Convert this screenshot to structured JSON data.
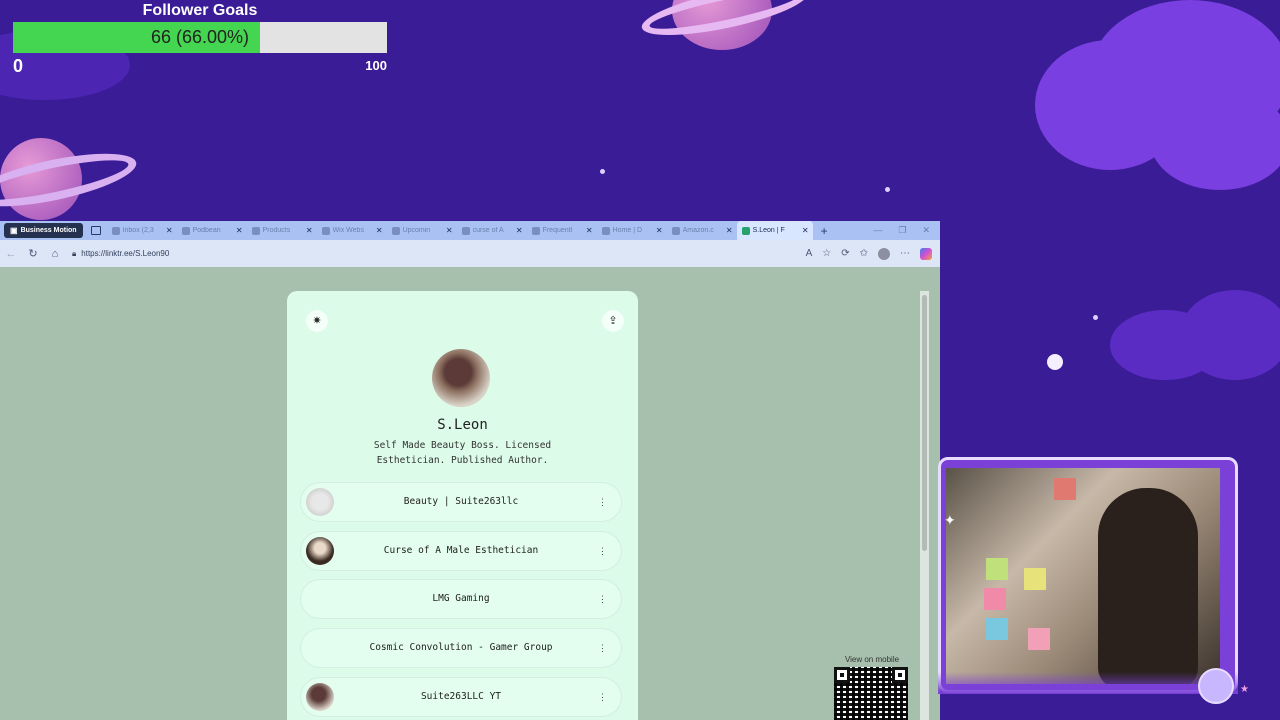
{
  "overlay": {
    "goal": {
      "title": "Follower Goals",
      "value_text": "66 (66.00%)",
      "min": "0",
      "max": "100",
      "progress": 0.66,
      "fill_color": "#44d650"
    }
  },
  "browser": {
    "workspace_label": "Business Motion",
    "tabs": [
      {
        "label": "Inbox (2,3",
        "active": false
      },
      {
        "label": "Podbean",
        "active": false
      },
      {
        "label": "Products",
        "active": false
      },
      {
        "label": "Wix Webs",
        "active": false
      },
      {
        "label": "Upcomin",
        "active": false
      },
      {
        "label": "curse of A",
        "active": false
      },
      {
        "label": "Frequentl",
        "active": false
      },
      {
        "label": "Home | D",
        "active": false
      },
      {
        "label": "Amazon.c",
        "active": false
      },
      {
        "label": "S.Leon | F",
        "active": true
      }
    ],
    "new_tab": "+",
    "url": "https://linktr.ee/S.Leon90"
  },
  "page": {
    "name": "S.Leon",
    "bio": "Self Made Beauty Boss. Licensed Esthetician. Published Author.",
    "links": [
      {
        "label": "Beauty | Suite263llc",
        "thumb": "logo"
      },
      {
        "label": "Curse of A Male Esthetician",
        "thumb": "book"
      },
      {
        "label": "LMG Gaming",
        "thumb": "none"
      },
      {
        "label": "Cosmic Convolution - Gamer Group",
        "thumb": "none"
      },
      {
        "label": "Suite263LLC YT",
        "thumb": "avatar"
      }
    ],
    "more_icon": "⋮",
    "qr_title": "View on mobile"
  },
  "colors": {
    "page_bg": "#a7c0ad",
    "card_bg": "#dcfbe9",
    "overlay_bg": "#3a1c96",
    "tabbar": "#a9c2f3"
  }
}
